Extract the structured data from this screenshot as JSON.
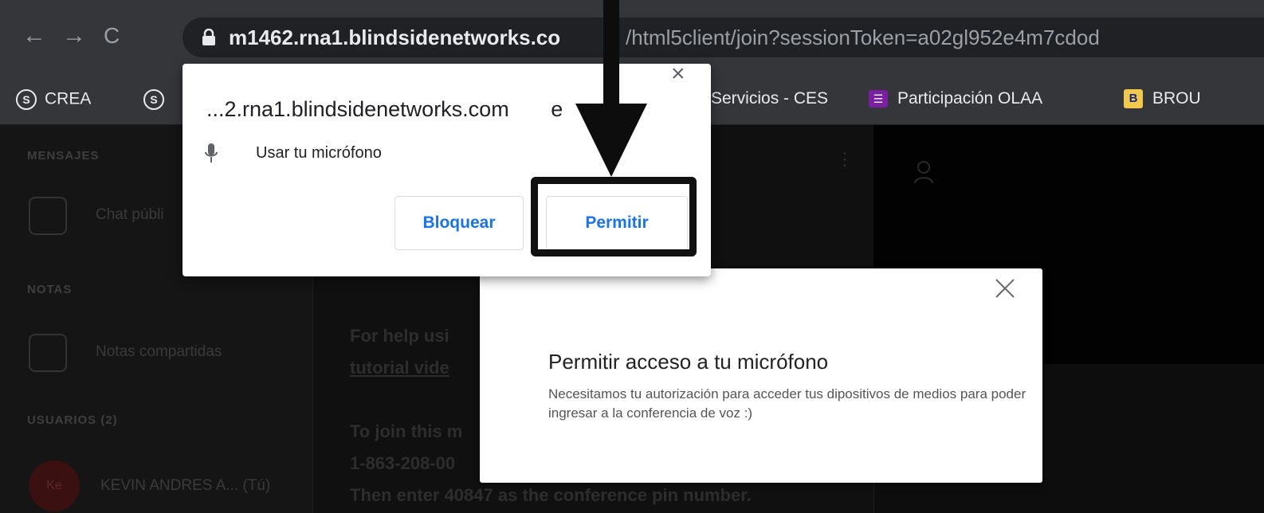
{
  "browser": {
    "url_host": "m1462.rna1.blindsidenetworks.co",
    "url_path": "/html5client/join?sessionToken=a02gl952e4m7cdod",
    "bookmarks": [
      {
        "label": "CREA",
        "icon": "s-circle-icon"
      },
      {
        "label": "",
        "icon": "s-circle-icon"
      },
      {
        "label": "Servicios - CES",
        "icon": "none"
      },
      {
        "label": "Participación OLAA",
        "icon": "list-icon",
        "color": "#7b1fa2"
      },
      {
        "label": "BROU",
        "icon": "brou-icon",
        "color": "#f2c94c"
      }
    ]
  },
  "permission_popup": {
    "title": "...2.rna1.blindsidenetworks.com",
    "title_suffix": "e",
    "permission": "Usar tu micrófono",
    "block_label": "Bloquear",
    "allow_label": "Permitir"
  },
  "dialog": {
    "title": "Permitir acceso a tu micrófono",
    "description": "Necesitamos tu autorización para acceder tus dipositivos de medios para poder ingresar a la conferencia de voz :)"
  },
  "background": {
    "section_messages": "MENSAJES",
    "chat_item": "Chat públi",
    "section_notes": "NOTAS",
    "notes_item": "Notas compartidas",
    "section_users": "USUARIOS (2)",
    "user_initials": "Ke",
    "user_name": "KEVIN ANDRES A... (Tú)",
    "chat_help": "For help usi",
    "chat_tutorial": "tutorial vide",
    "chat_join": "To join this m",
    "chat_phone": "1-863-208-00",
    "chat_pin": "Then enter 40847 as the conference pin number."
  }
}
